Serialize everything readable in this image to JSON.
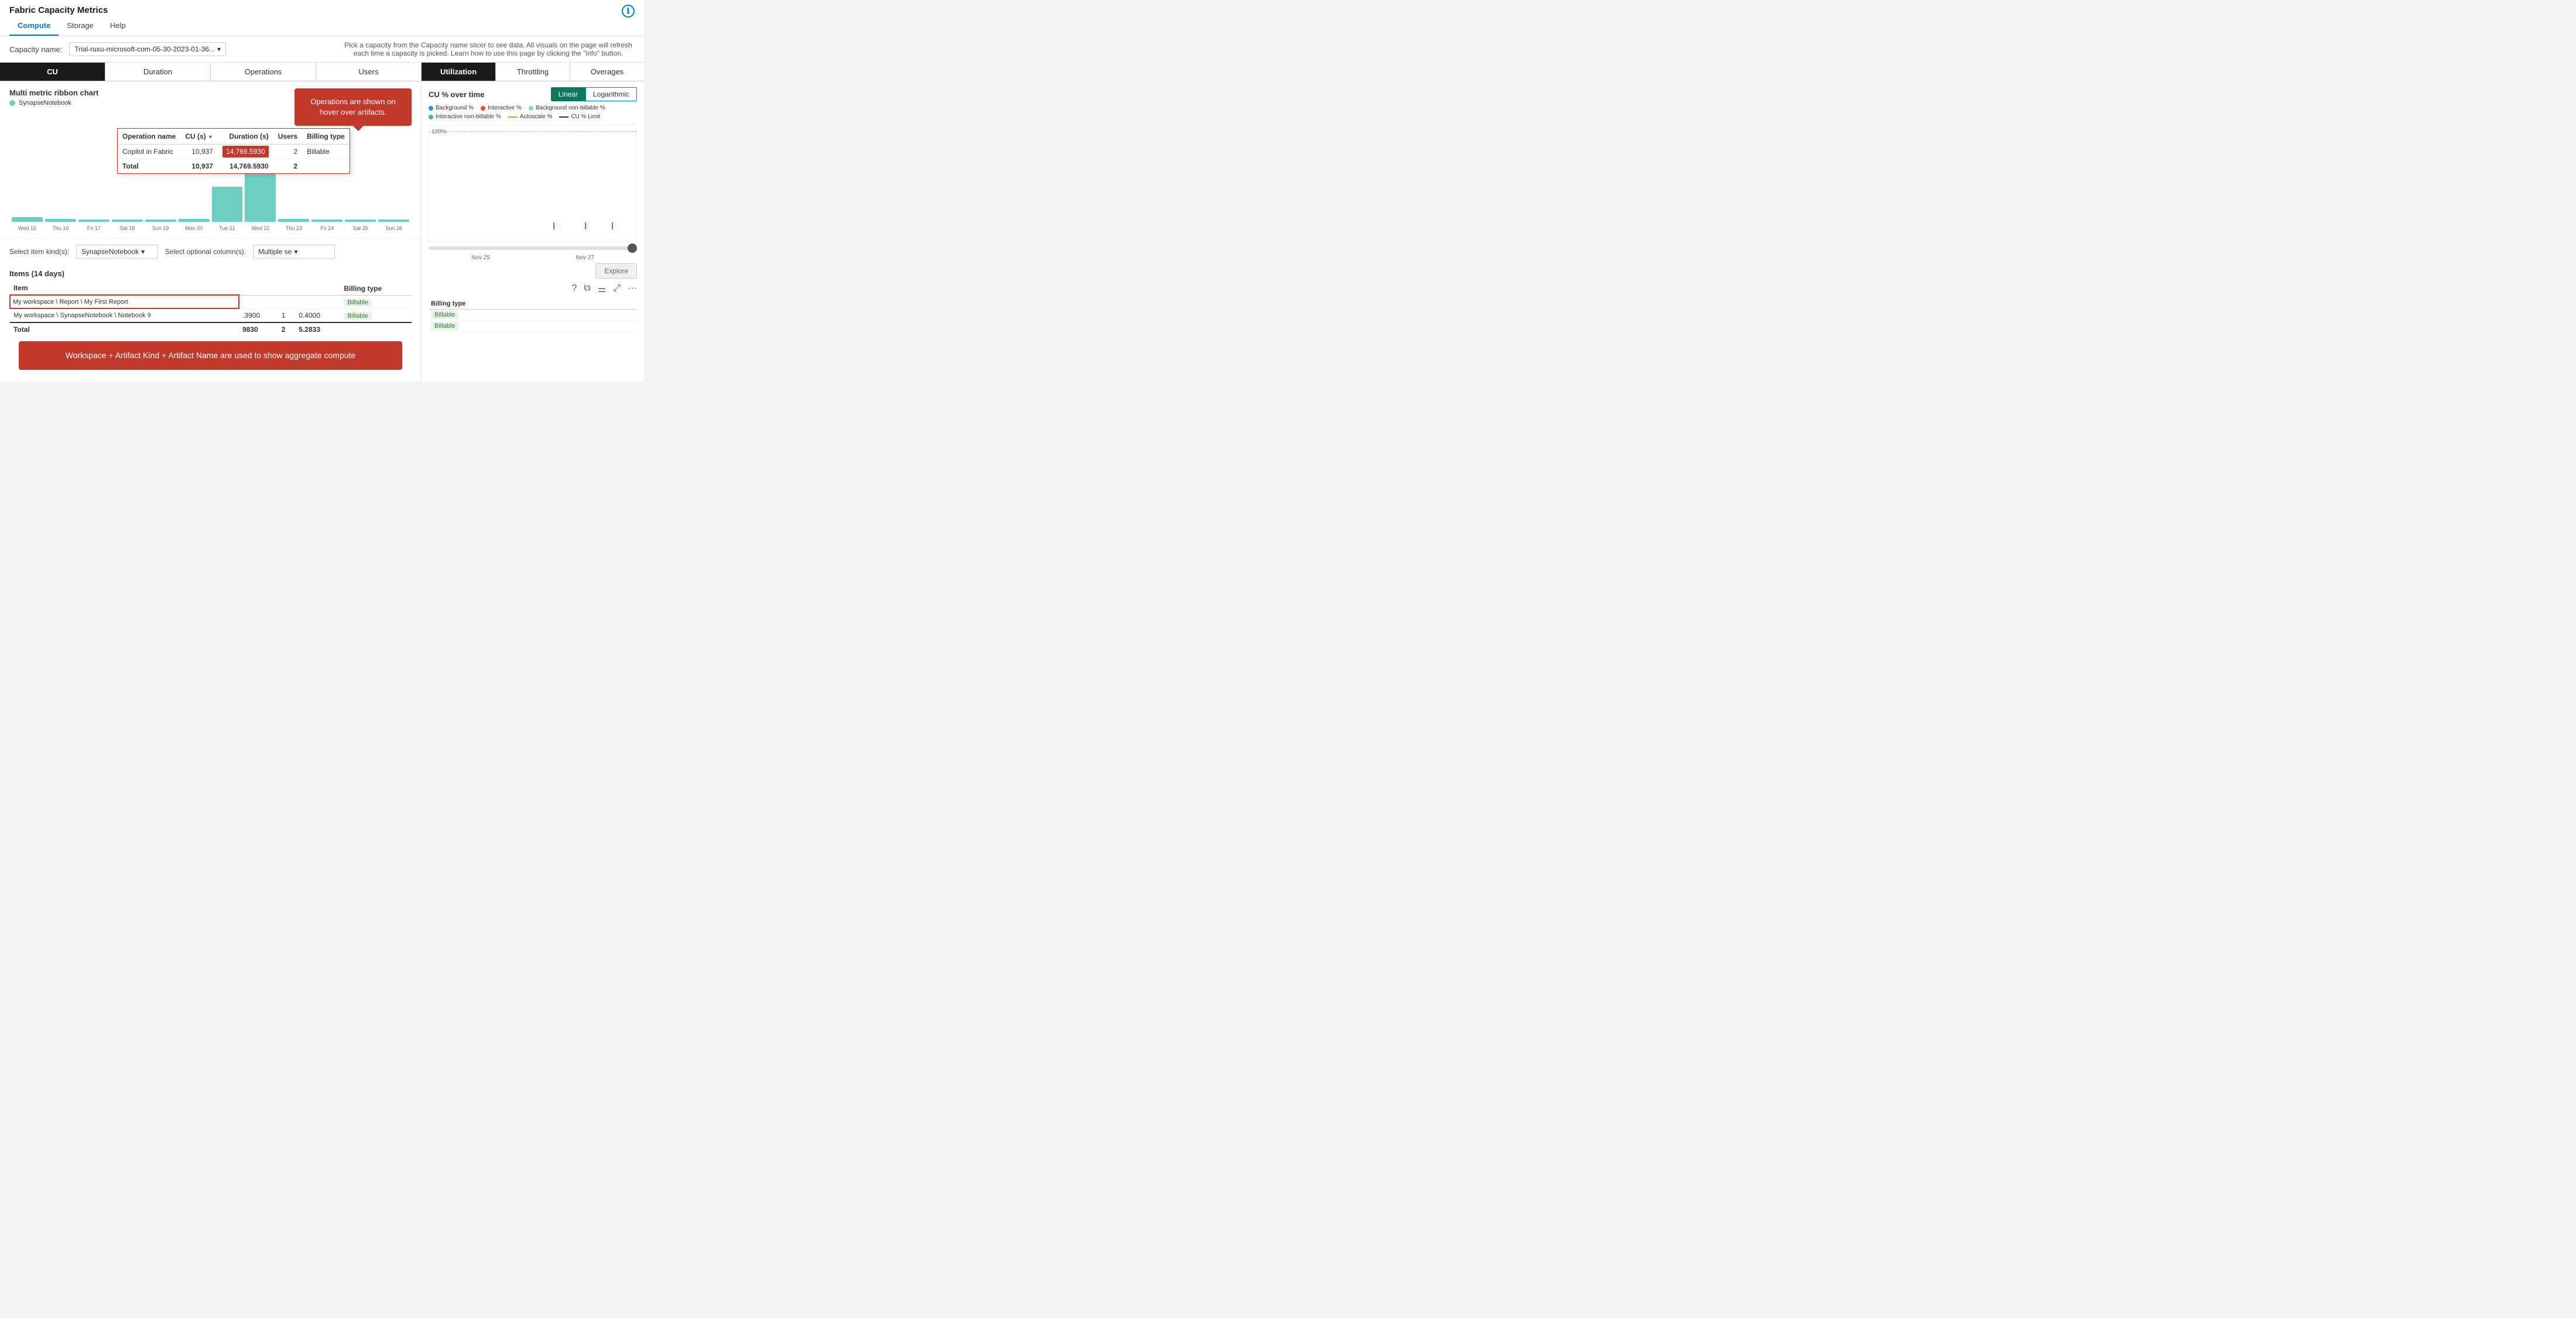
{
  "app": {
    "title": "Fabric Capacity Metrics",
    "info_icon": "ℹ"
  },
  "nav": {
    "tabs": [
      "Compute",
      "Storage",
      "Help"
    ],
    "active": "Compute"
  },
  "toolbar": {
    "capacity_label": "Capacity name:",
    "capacity_value": "Trial-ruxu-microsoft-com-05-30-2023-01-36...",
    "notice": "Pick a capacity from the Capacity name slicer to see data. All visuals on the page will refresh each time a capacity is picked. Learn how to use this page by clicking the \"info\" button."
  },
  "metric_tabs": {
    "tabs": [
      "CU",
      "Duration",
      "Operations",
      "Users"
    ],
    "active": "CU"
  },
  "chart": {
    "title": "Multi metric ribbon chart",
    "legend_label": "SynapseNotebook",
    "legend_color": "#6ecfc0",
    "tooltip_bubble": "Operations are shown on hover over artifacts.",
    "bars": [
      {
        "label": "Wed 15",
        "height": 8
      },
      {
        "label": "Thu 16",
        "height": 5
      },
      {
        "label": "Fri 17",
        "height": 4
      },
      {
        "label": "Sat 18",
        "height": 4
      },
      {
        "label": "Sun 19",
        "height": 4
      },
      {
        "label": "Mon 20",
        "height": 5
      },
      {
        "label": "Tue 21",
        "height": 60
      },
      {
        "label": "Wed 22",
        "height": 100
      },
      {
        "label": "Thu 23",
        "height": 5
      },
      {
        "label": "Fri 24",
        "height": 4
      },
      {
        "label": "Sat 25",
        "height": 4
      },
      {
        "label": "Sun 26",
        "height": 4
      }
    ]
  },
  "op_popup": {
    "headers": [
      "Operation name",
      "CU (s)",
      "Duration (s)",
      "Users",
      "Billing type"
    ],
    "rows": [
      {
        "name": "Copilot in Fabric",
        "cu": "10,937",
        "duration": "14,769.5930",
        "users": "2",
        "billing": "Billable"
      }
    ],
    "total": {
      "label": "Total",
      "cu": "10,937",
      "duration": "14,769.5930",
      "users": "2"
    }
  },
  "bottom_controls": {
    "item_kind_label": "Select item kind(s):",
    "item_kind_value": "SynapseNotebook",
    "col_label": "Select optional column(s):",
    "col_value": "Multiple se"
  },
  "items_section": {
    "title": "Items (14 days)",
    "col_item": "Item",
    "rows": [
      {
        "item": "My workspace \\ Report \\ My First Report",
        "highlighted": true,
        "col2": "",
        "col3": "",
        "col4": "",
        "billing": "Billable"
      },
      {
        "item": "My workspace \\ SynapseNotebook \\ Notebook 9",
        "col2": ".3900",
        "col3": "1",
        "col4": "0.4000",
        "billing": "Billable"
      },
      {
        "item": "Total",
        "col2": "9830",
        "col3": "2",
        "col4": "5.2833",
        "billing": "",
        "is_total": true
      }
    ],
    "annotation": "Workspace + Artifact Kind + Artifact Name are used to show aggregate compute"
  },
  "util_tabs": {
    "tabs": [
      "Utilization",
      "Throttling",
      "Overages"
    ],
    "active": "Utilization"
  },
  "right_chart": {
    "title": "CU % over time",
    "scale_linear": "Linear",
    "scale_log": "Logarithmic",
    "active_scale": "Linear",
    "legend": [
      {
        "label": "Background %",
        "color": "#1e90ff",
        "type": "circle"
      },
      {
        "label": "Interactive %",
        "color": "#e74c3c",
        "type": "circle"
      },
      {
        "label": "Background non-billable %",
        "color": "#87ceeb",
        "type": "circle"
      },
      {
        "label": "Interactive non-billable %",
        "color": "#2ecc71",
        "type": "circle"
      },
      {
        "label": "Autoscale %",
        "color": "#e5a100",
        "type": "dash"
      },
      {
        "label": "CU % Limit",
        "color": "#333",
        "type": "dash"
      }
    ],
    "y_label": "100%",
    "x_labels": [
      "Nov 25",
      "Nov 27"
    ],
    "explore_btn": "Explore"
  },
  "right_table": {
    "col_billing": "Billing type",
    "rows": [
      {
        "billing": "Billable"
      },
      {
        "billing": "Billable"
      }
    ]
  },
  "icons": {
    "help": "?",
    "copy": "⧉",
    "filter": "⚌",
    "expand": "⤢",
    "more": "···"
  }
}
